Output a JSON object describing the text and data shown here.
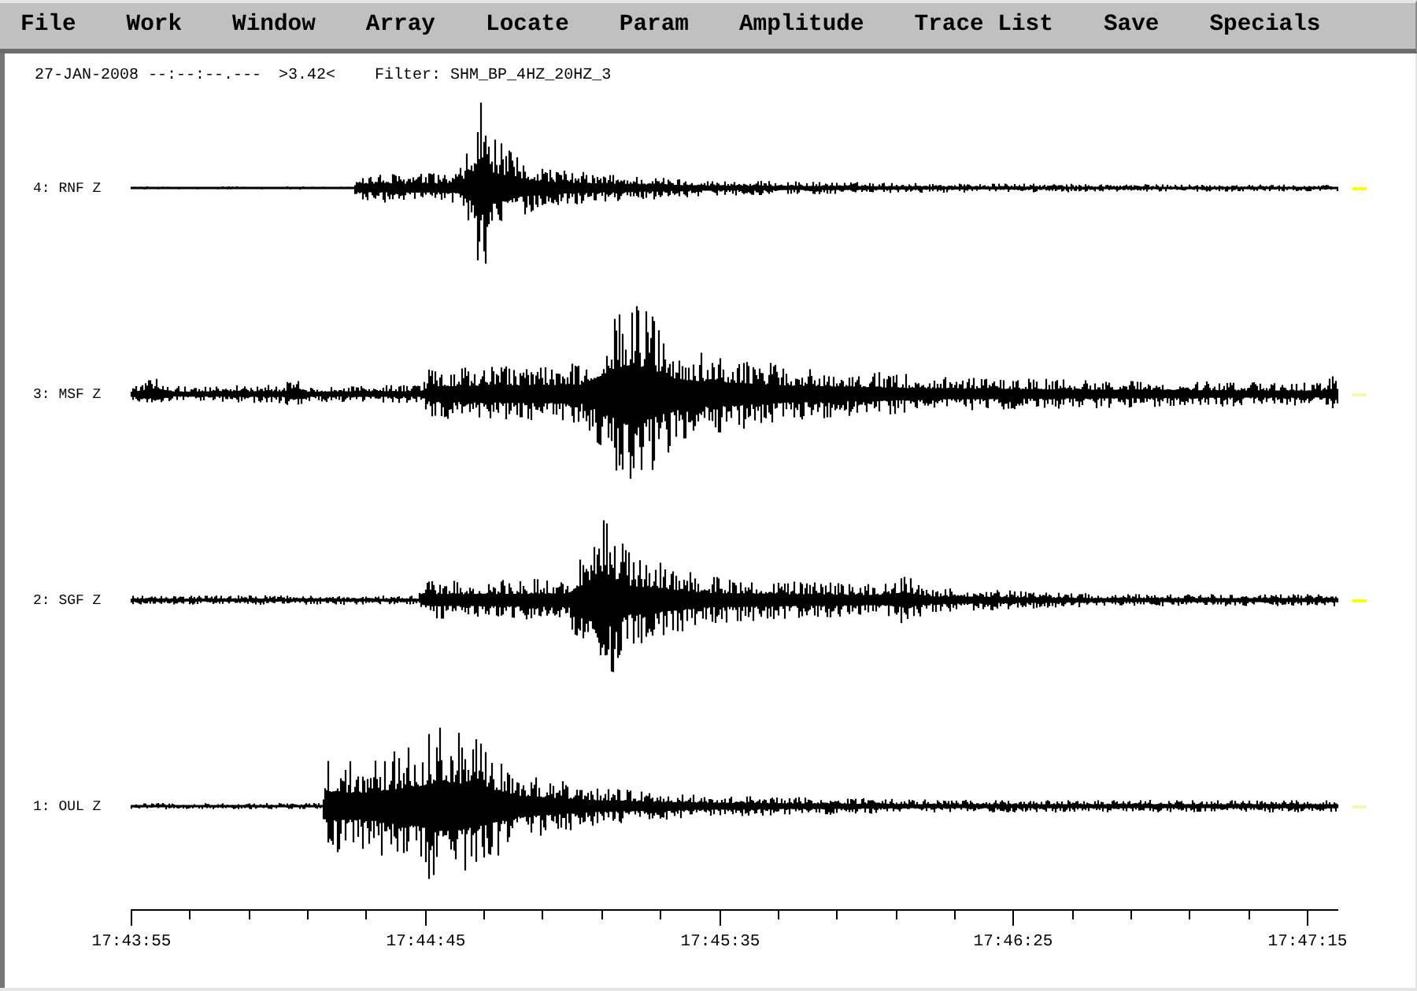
{
  "menu": [
    "File",
    "Work",
    "Window",
    "Array",
    "Locate",
    "Param",
    "Amplitude",
    "Trace List",
    "Save",
    "Specials"
  ],
  "header": {
    "date_time": "27-JAN-2008 --:--:--.---",
    "scale": ">3.42<",
    "filter": "Filter: SHM_BP_4HZ_20HZ_3"
  },
  "traces": [
    {
      "label": "4: RNF Z",
      "selected": true
    },
    {
      "label": "3: MSF Z",
      "selected": false
    },
    {
      "label": "2: SGF Z",
      "selected": true
    },
    {
      "label": "1: OUL Z",
      "selected": false
    }
  ],
  "time_axis": {
    "tick_labels": [
      "17:43:55",
      "17:44:45",
      "17:45:35",
      "17:46:25",
      "17:47:15"
    ]
  }
}
